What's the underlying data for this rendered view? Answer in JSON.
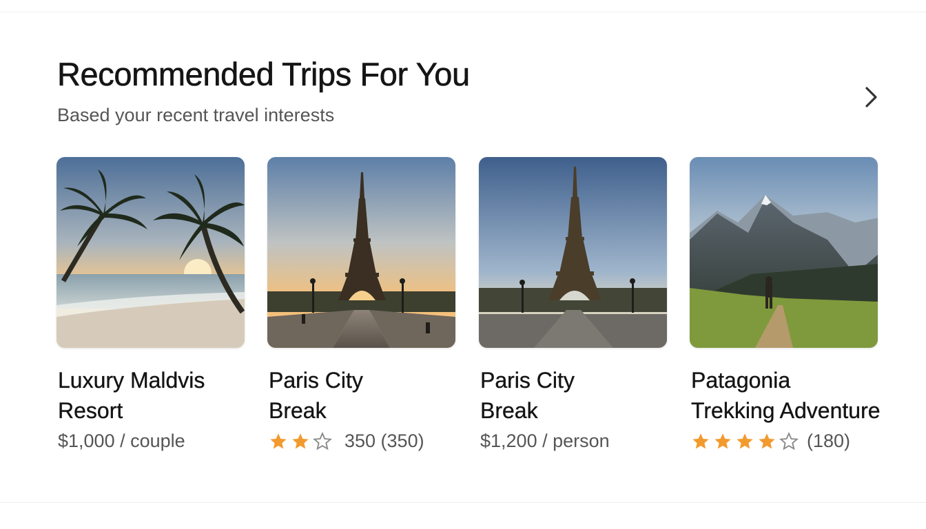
{
  "section": {
    "title": "Recommended Trips For You",
    "subtitle": "Based your recent travel interests"
  },
  "navigation": {
    "next_icon": "chevron-right-icon"
  },
  "colors": {
    "star": "#F29A2E",
    "star_outline": "#888888"
  },
  "trips": [
    {
      "title_line1": "Luxury Maldvis",
      "title_line2": "Resort",
      "price": "$1,000 / couple",
      "image": "palm-beach-sunset"
    },
    {
      "title_line1": "Paris City",
      "title_line2": "Break",
      "rating_stars": 3,
      "rating_text": "350 (350)",
      "image": "eiffel-tower-sunset"
    },
    {
      "title_line1": "Paris City",
      "title_line2": "Break",
      "price": "$1,200 / person",
      "image": "eiffel-tower-blue-sky"
    },
    {
      "title_line1": "Patagonia",
      "title_line2": "Trekking Adventure",
      "rating_stars": 5,
      "rating_text": "(180)",
      "image": "mountain-hiker"
    }
  ]
}
